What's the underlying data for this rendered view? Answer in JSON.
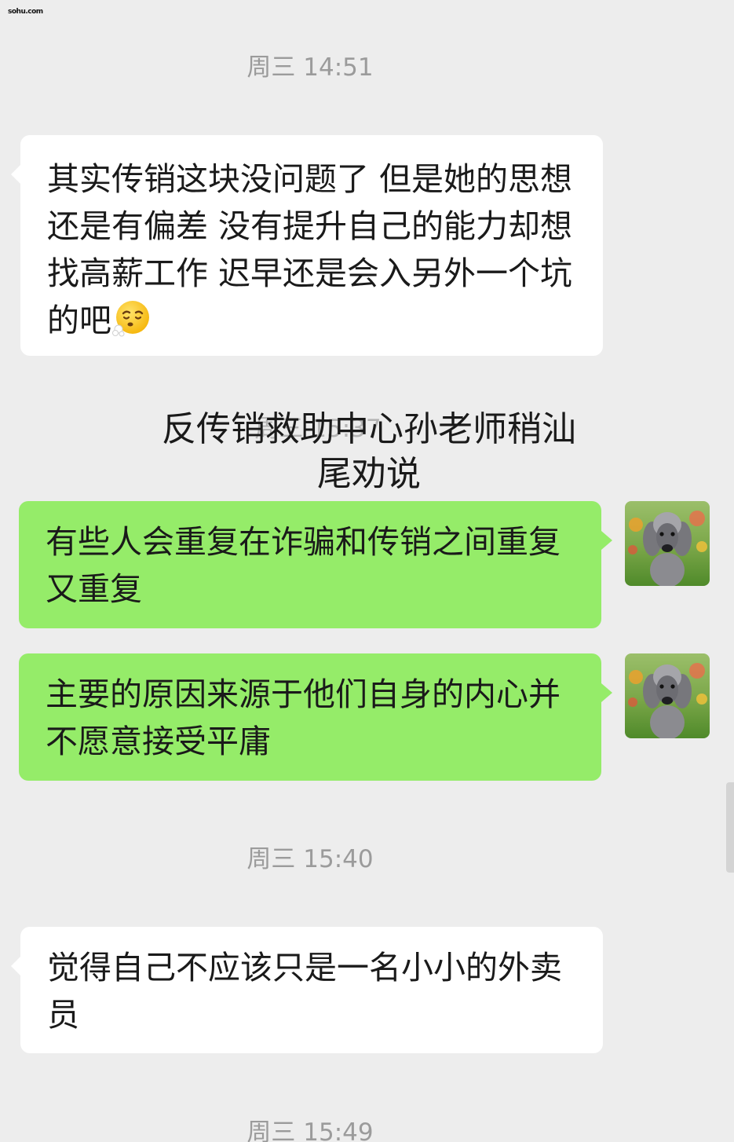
{
  "corner_mark": "sohu.com",
  "timestamps": {
    "t1": "周三 14:51",
    "t2_ghost": "周三 15:37",
    "t3": "周三 15:40",
    "t4": "周三 15:49"
  },
  "messages": {
    "m1": {
      "sender": "other",
      "text": "其实传销这块没问题了 但是她的思想还是有偏差 没有提升自己的能力却想找高薪工作 迟早还是会入另外一个坑的吧",
      "emoji": "sighing-face"
    },
    "m2": {
      "sender": "self",
      "text": "有些人会重复在诈骗和传销之间重复又重复"
    },
    "m3": {
      "sender": "self",
      "text": "主要的原因来源于他们自身的内心并不愿意接受平庸"
    },
    "m4": {
      "sender": "other",
      "text": "觉得自己不应该只是一名小小的外卖员"
    }
  },
  "overlay_caption": "反传销救助中心孙老师稍汕尾劝说",
  "avatar": {
    "icon": "poodle-dog-avatar"
  },
  "colors": {
    "background": "#ededed",
    "incoming_bubble": "#ffffff",
    "outgoing_bubble": "#95ec69",
    "timestamp": "#9b9b9b"
  }
}
